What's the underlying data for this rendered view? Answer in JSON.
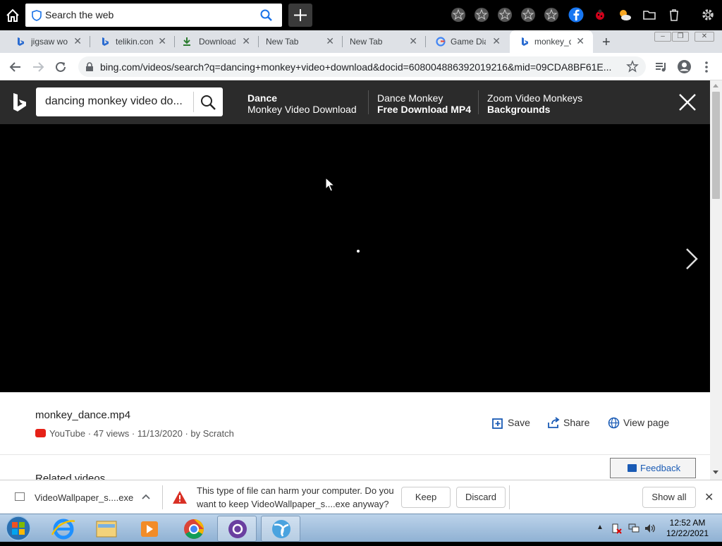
{
  "toolbar": {
    "search_text": "Search the web"
  },
  "tabs": [
    {
      "label": "jigsaw wo",
      "favicon": "bing-icon"
    },
    {
      "label": "telikin.con",
      "favicon": "bing-icon"
    },
    {
      "label": "Download",
      "favicon": "download-icon"
    },
    {
      "label": "New Tab",
      "favicon": ""
    },
    {
      "label": "New Tab",
      "favicon": ""
    },
    {
      "label": "Game Diar",
      "favicon": "google-icon"
    },
    {
      "label": "monkey_d",
      "favicon": "bing-icon"
    }
  ],
  "address": {
    "url": "bing.com/videos/search?q=dancing+monkey+video+download&docid=608004886392019216&mid=09CDA8BF61E..."
  },
  "bing": {
    "query": "dancing monkey video do...",
    "related": [
      {
        "line1": "Dance",
        "line2": "Monkey Video Download",
        "bold_line": 1
      },
      {
        "line1": "Dance Monkey",
        "line2": "Free Download MP4",
        "bold_line": 2
      },
      {
        "line1": "Zoom Video Monkeys",
        "line2": "Backgrounds",
        "bold_line": 2
      }
    ]
  },
  "video": {
    "title": "monkey_dance.mp4",
    "meta": "YouTube · 47 views · 11/13/2020 · by Scratch",
    "actions": {
      "save": "Save",
      "share": "Share",
      "view_page": "View page"
    },
    "related_header": "Related videos",
    "feedback": "Feedback"
  },
  "download_bar": {
    "filename": "VideoWallpaper_s....exe",
    "warning": "This type of file can harm your computer. Do you want to keep VideoWallpaper_s....exe anyway?",
    "keep": "Keep",
    "discard": "Discard",
    "show_all": "Show all"
  },
  "taskbar": {
    "time": "12:52 AM",
    "date": "12/22/2021"
  },
  "colors": {
    "bing_header": "#2b2b2b",
    "facebook": "#1877f2",
    "youtube": "#e62117",
    "link_blue": "#1a5bb5"
  }
}
